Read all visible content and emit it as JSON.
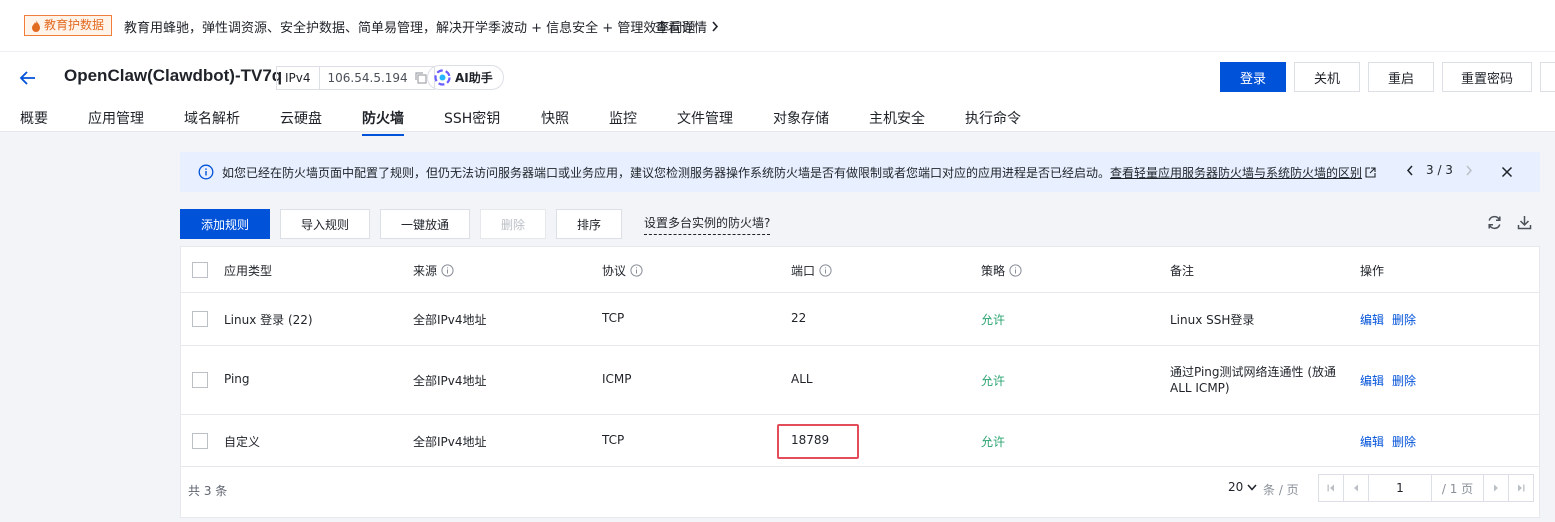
{
  "promo": {
    "tag": "教育护数据",
    "text": "教育用蜂驰，弹性调资源、安全护数据、简单易管理，解决开学季波动 + 信息安全 + 管理效率问题",
    "link": "查看详情"
  },
  "header": {
    "title": "OpenClaw(Clawdbot)-TV7q",
    "ip_label": "IPv4",
    "ip_value": "106.54.5.194",
    "ai_label": "AI助手",
    "buttons": {
      "login": "登录",
      "shutdown": "关机",
      "restart": "重启",
      "reset_password": "重置密码"
    }
  },
  "tabs": [
    "概要",
    "应用管理",
    "域名解析",
    "云硬盘",
    "防火墙",
    "SSH密钥",
    "快照",
    "监控",
    "文件管理",
    "对象存储",
    "主机安全",
    "执行命令"
  ],
  "active_tab": "防火墙",
  "notice": {
    "text": "如您已经在防火墙页面中配置了规则，但仍无法访问服务器端口或业务应用，建议您检测服务器操作系统防火墙是否有做限制或者您端口对应的应用进程是否已经启动。",
    "link": "查看轻量应用服务器防火墙与系统防火墙的区别",
    "pager": "3 / 3"
  },
  "toolbar": {
    "add": "添加规则",
    "import": "导入规则",
    "allow_all": "一键放通",
    "delete": "删除",
    "sort": "排序",
    "multi_link": "设置多台实例的防火墙?"
  },
  "table": {
    "headers": {
      "type": "应用类型",
      "source": "来源",
      "protocol": "协议",
      "port": "端口",
      "policy": "策略",
      "note": "备注",
      "action": "操作"
    },
    "rows": [
      {
        "type": "Linux 登录 (22)",
        "source": "全部IPv4地址",
        "protocol": "TCP",
        "port": "22",
        "policy": "允许",
        "note1": "Linux SSH登录",
        "note2": "",
        "edit": "编辑",
        "del": "删除"
      },
      {
        "type": "Ping",
        "source": "全部IPv4地址",
        "protocol": "ICMP",
        "port": "ALL",
        "policy": "允许",
        "note1": "通过Ping测试网络连通性 (放通",
        "note2": "ALL ICMP)",
        "edit": "编辑",
        "del": "删除"
      },
      {
        "type": "自定义",
        "source": "全部IPv4地址",
        "protocol": "TCP",
        "port": "18789",
        "policy": "允许",
        "note1": "",
        "note2": "",
        "edit": "编辑",
        "del": "删除"
      }
    ]
  },
  "footer": {
    "total": "共 3 条",
    "page_size": "20",
    "page_size_unit": "条 / 页",
    "current_page": "1",
    "total_pages": "/ 1 页"
  }
}
